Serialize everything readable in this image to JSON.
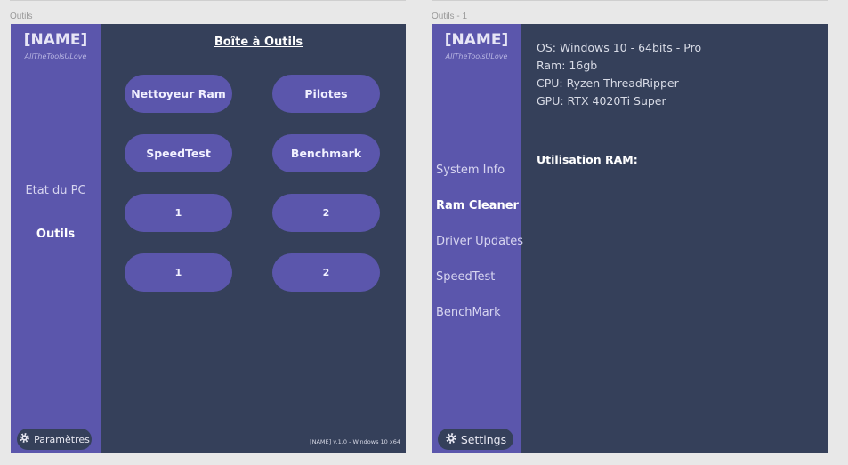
{
  "frames": [
    {
      "label": "Outils"
    },
    {
      "label": "Outils - 1"
    }
  ],
  "outils": {
    "brand": "[NAME]",
    "tagline": "AllTheToolsULove",
    "nav": [
      "Etat du PC",
      "Outils"
    ],
    "settings_label": "Paramètres",
    "title": "Boîte à Outils",
    "buttons": [
      "Nettoyeur Ram",
      "Pilotes",
      "SpeedTest",
      "Benchmark",
      "1",
      "2",
      "1",
      "2"
    ],
    "version": "[NAME]  v.1.0 - Windows 10 x64"
  },
  "outils1": {
    "brand": "[NAME]",
    "tagline": "AllTheToolsULove",
    "nav": [
      "System Info",
      "Ram Cleaner",
      "Driver Updates",
      "SpeedTest",
      "BenchMark"
    ],
    "settings_label": "Settings",
    "sysinfo": [
      "OS: Windows 10 - 64bits - Pro",
      "Ram: 16gb",
      "CPU: Ryzen ThreadRipper",
      "GPU: RTX 4020Ti Super"
    ],
    "ram_usage_label": "Utilisation RAM:"
  },
  "colors": {
    "sidebar": "#5b56ac",
    "content": "#35405a",
    "canvas": "#e8e8e8"
  },
  "icons": {
    "settings": "gear-icon"
  }
}
